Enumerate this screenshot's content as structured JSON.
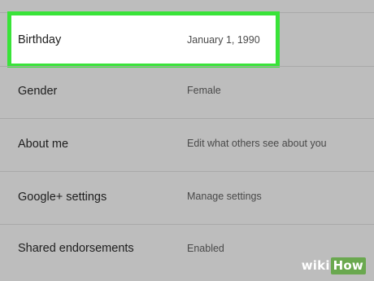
{
  "settings": {
    "rows": [
      {
        "label": "Birthday",
        "value": "January 1, 1990"
      },
      {
        "label": "Gender",
        "value": "Female"
      },
      {
        "label": "About me",
        "value": "Edit what others see about you"
      },
      {
        "label": "Google+ settings",
        "value": "Manage settings"
      },
      {
        "label": "Shared endorsements",
        "value": "Enabled"
      }
    ],
    "highlight_color": "#39e339"
  },
  "watermark": {
    "wiki": "wiki",
    "how": "How"
  }
}
